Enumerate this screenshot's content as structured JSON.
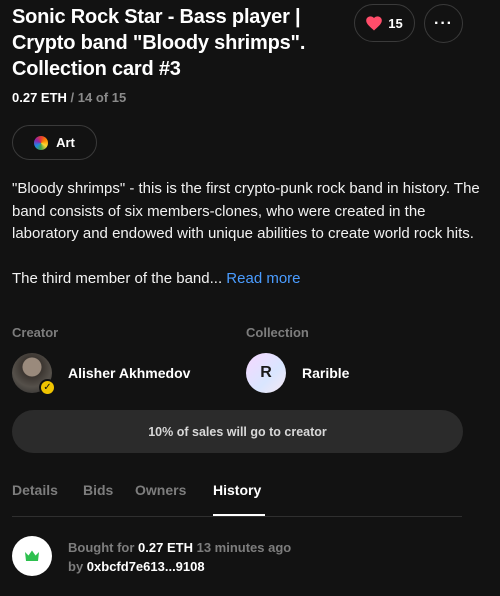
{
  "item": {
    "title": "Sonic Rock Star - Bass player | Crypto band \"Bloody shrimps\". Collection card #3",
    "price": "0.27 ETH",
    "price_sep": " / ",
    "edition": "14 of 15",
    "likes": "15",
    "more_label": "···",
    "tag": "Art",
    "description_p1": "\"Bloody shrimps\" - this is the first crypto-punk rock band in history. The band consists of six members-clones, who were created in the laboratory and endowed with unique abilities to create world rock hits.",
    "description_p2": "The third member of the band...",
    "read_more": "Read more"
  },
  "creator": {
    "label": "Creator",
    "name": "Alisher Akhmedov"
  },
  "collection": {
    "label": "Collection",
    "name": "Rarible",
    "avatar_letter": "R"
  },
  "royalty_text": "10% of sales will go to creator",
  "tabs": [
    {
      "label": "Details"
    },
    {
      "label": "Bids"
    },
    {
      "label": "Owners"
    },
    {
      "label": "History"
    }
  ],
  "active_tab": "History",
  "history": [
    {
      "action": "Bought for",
      "amount": "0.27 ETH",
      "time": "13 minutes ago",
      "by_label": "by",
      "address": "0xbcfd7e613...9108"
    }
  ],
  "colors": {
    "background": "#121212",
    "heart": "#ff4d6a",
    "link": "#4a9cff",
    "verified": "#f0c400",
    "history_icon": "#2ec04f"
  },
  "icons": {
    "like": "heart-icon",
    "more": "more-dots-icon",
    "tag": "rainbow-icon",
    "verified": "verified-badge-icon",
    "history": "crown-icon"
  }
}
